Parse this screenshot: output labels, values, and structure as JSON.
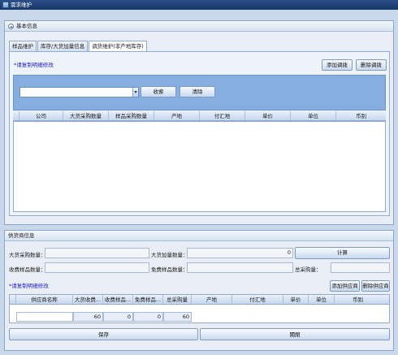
{
  "window": {
    "title": "需求维护"
  },
  "basic_panel": {
    "title": "基本信息"
  },
  "tabs": [
    {
      "label": "样品维护"
    },
    {
      "label": "库存/大货加量信息"
    },
    {
      "label": "调货维护(非产地库存)"
    }
  ],
  "tab_body": {
    "note": "*请复制明细修改",
    "add_transfer": "添加调拨",
    "delete_transfer": "删除调拨",
    "search": "收索",
    "clear": "清除",
    "columns": [
      "公司",
      "大货采购数量",
      "样品采购数量",
      "产地",
      "付汇地",
      "单价",
      "单位",
      "币别"
    ]
  },
  "supplier_panel": {
    "title": "供货商信息",
    "bulk_purchase_qty_label": "大货采购数量：",
    "bulk_purchase_qty_value": "",
    "bulk_add_qty_label": "大货加量数量：",
    "bulk_add_qty_value": "0",
    "calculate": "计算",
    "sample_charge_qty_label": "收费样品数量：",
    "sample_charge_qty_value": "",
    "sample_free_qty_label": "免费样品数量：",
    "sample_free_qty_value": "",
    "total_purchase_qty_label": "总采购量：",
    "total_purchase_qty_value": "",
    "note": "*请复制明细修改",
    "add_supplier": "添加供应商",
    "delete_supplier": "删除供应商",
    "columns": [
      "供应商名称",
      "大货收费...",
      "收费样品...",
      "免费样品...",
      "总采购量",
      "产地",
      "付汇地",
      "单价",
      "单位",
      "币别"
    ],
    "row": [
      "",
      "60",
      "0",
      "0",
      "60"
    ],
    "save": "保存",
    "close": "關閉"
  },
  "colors": {
    "title_bar": "#1f3f74",
    "filter_bar": "#87aee0",
    "note_text": "#2222cc"
  }
}
